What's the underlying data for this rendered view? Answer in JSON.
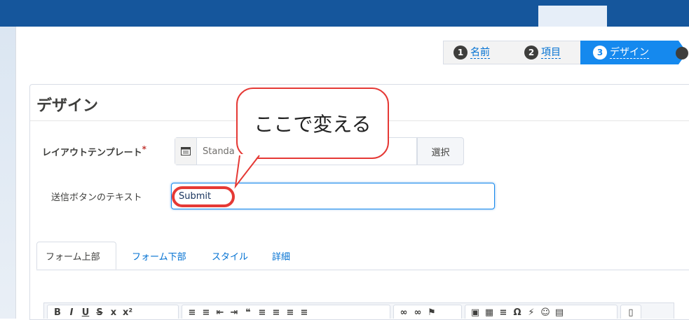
{
  "wizard": {
    "steps": [
      {
        "num": "1",
        "label": "名前"
      },
      {
        "num": "2",
        "label": "項目"
      },
      {
        "num": "3",
        "label": "デザイン"
      }
    ]
  },
  "card": {
    "title": "デザイン"
  },
  "layout_template": {
    "label": "レイアウトテンプレート",
    "required_mark": "*",
    "value": "Standa",
    "select_button": "選択"
  },
  "submit_text": {
    "label": "送信ボタンのテキスト",
    "value": "Submit"
  },
  "callout": {
    "text": "ここで変える"
  },
  "tabs": [
    {
      "label": "フォーム上部"
    },
    {
      "label": "フォーム下部"
    },
    {
      "label": "スタイル"
    },
    {
      "label": "詳細"
    }
  ],
  "toolbar": {
    "bold": "B",
    "italic": "I",
    "underline": "U",
    "strike": "S",
    "subscript": "x",
    "superscript": "x²"
  },
  "colors": {
    "accent": "#1589ee",
    "link": "#0070d2",
    "highlight": "#e53935",
    "header": "#15569c"
  }
}
